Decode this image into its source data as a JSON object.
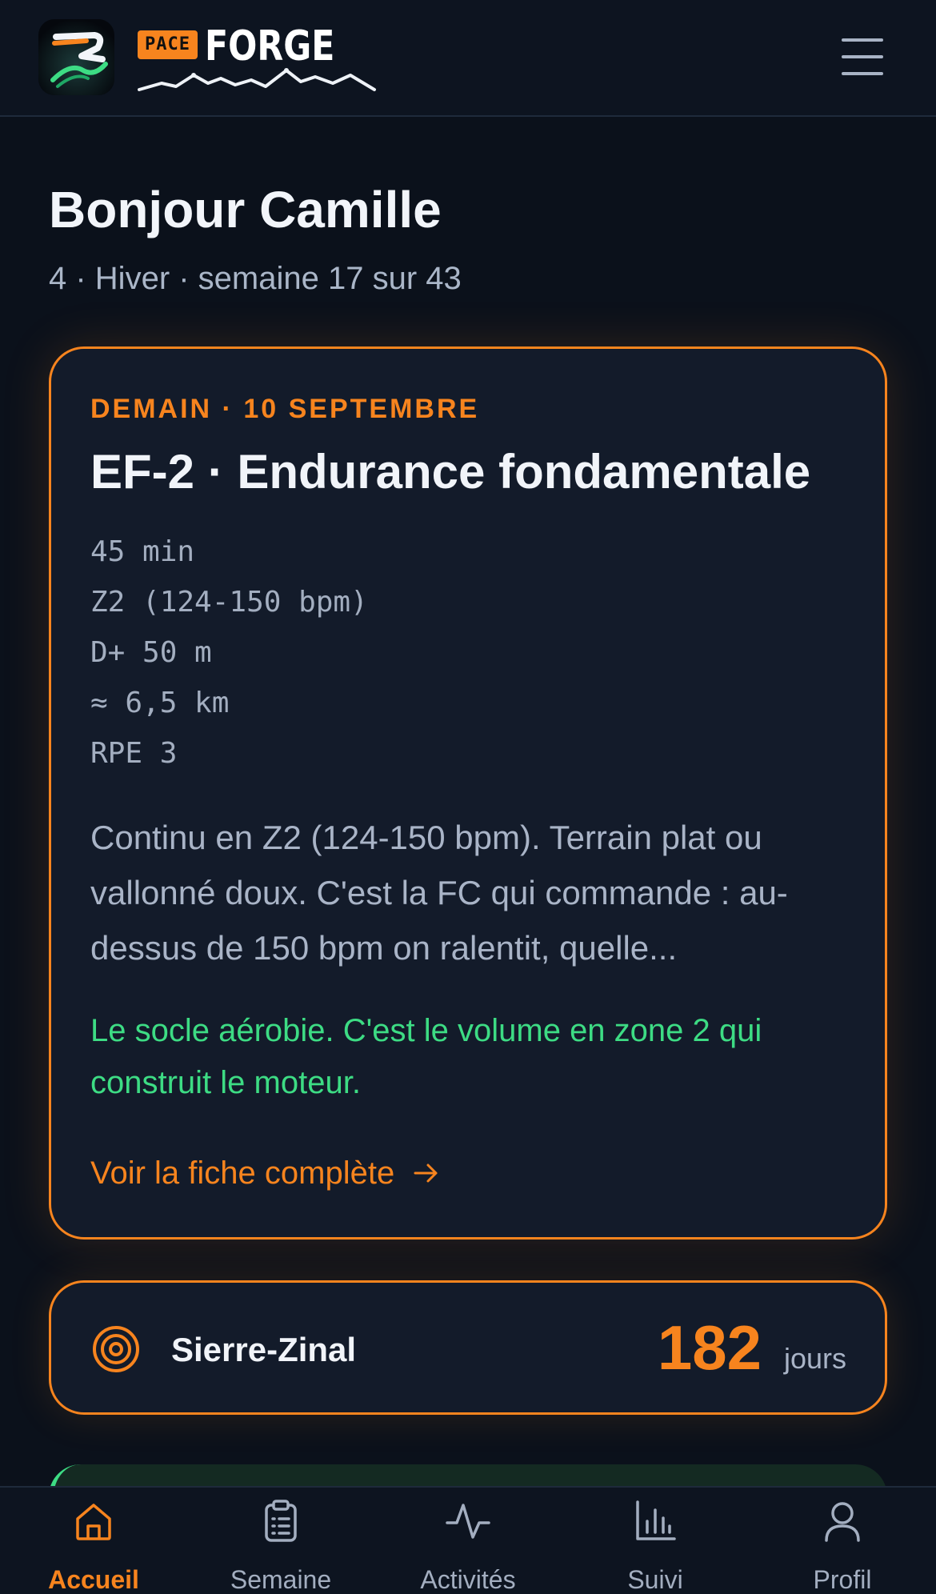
{
  "header": {
    "logo_badge": "PACE",
    "logo_word": "FORGE"
  },
  "greeting": {
    "title": "Bonjour Camille",
    "subtitle": "4 · Hiver · semaine 17 sur 43"
  },
  "session": {
    "date_label": "DEMAIN · 10 SEPTEMBRE",
    "title": "EF-2 · Endurance fondamentale",
    "metrics": [
      "45 min",
      "Z2 (124-150 bpm)",
      "D+ 50 m",
      "≈ 6,5 km",
      "RPE 3"
    ],
    "description": "Continu en Z2 (124-150 bpm). Terrain plat ou vallonné doux. C'est la FC qui commande : au-dessus de 150 bpm on ralentit, quelle...",
    "note": "Le socle aérobie. C'est le volume en zone 2 qui construit le moteur.",
    "link_label": "Voir la fiche complète"
  },
  "race": {
    "name": "Sierre-Zinal",
    "days": "182",
    "unit": "jours"
  },
  "nav": {
    "items": [
      {
        "label": "Accueil",
        "icon": "home-icon",
        "active": true
      },
      {
        "label": "Semaine",
        "icon": "clipboard-icon",
        "active": false
      },
      {
        "label": "Activités",
        "icon": "activity-icon",
        "active": false
      },
      {
        "label": "Suivi",
        "icon": "bar-chart-icon",
        "active": false
      },
      {
        "label": "Profil",
        "icon": "user-icon",
        "active": false
      }
    ]
  },
  "colors": {
    "accent": "#f7841e",
    "success": "#3ddc84",
    "background": "#0b111b",
    "card": "#131b2a"
  }
}
